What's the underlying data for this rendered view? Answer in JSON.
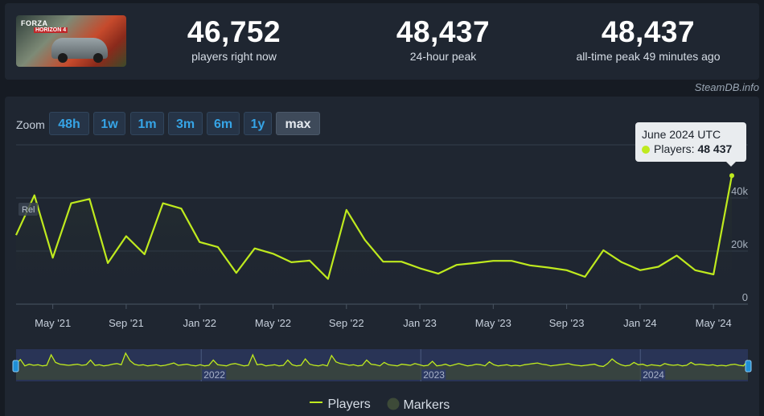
{
  "header": {
    "game_title_logo": "FORZA HORIZON 4",
    "stats": [
      {
        "value": "46,752",
        "label": "players right now"
      },
      {
        "value": "48,437",
        "label": "24-hour peak"
      },
      {
        "value": "48,437",
        "label": "all-time peak 49 minutes ago"
      }
    ]
  },
  "credit": "SteamDB.info",
  "zoom": {
    "label": "Zoom",
    "buttons": [
      "48h",
      "1w",
      "1m",
      "3m",
      "6m",
      "1y",
      "max"
    ],
    "active": "max"
  },
  "tooltip": {
    "title": "June 2024 UTC",
    "series": "Players:",
    "value": "48 437"
  },
  "chart_data": {
    "type": "line",
    "series": [
      {
        "name": "Players",
        "color": "#bfea1e",
        "x": [
          "2021-03",
          "2021-04",
          "2021-05",
          "2021-06",
          "2021-07",
          "2021-08",
          "2021-09",
          "2021-10",
          "2021-11",
          "2021-12",
          "2022-01",
          "2022-02",
          "2022-03",
          "2022-04",
          "2022-05",
          "2022-06",
          "2022-07",
          "2022-08",
          "2022-09",
          "2022-10",
          "2022-11",
          "2022-12",
          "2023-01",
          "2023-02",
          "2023-03",
          "2023-04",
          "2023-05",
          "2023-06",
          "2023-07",
          "2023-08",
          "2023-09",
          "2023-10",
          "2023-11",
          "2023-12",
          "2024-01",
          "2024-02",
          "2024-03",
          "2024-04",
          "2024-05",
          "2024-06"
        ],
        "values": [
          26000,
          41000,
          17500,
          38000,
          39600,
          15500,
          25600,
          18800,
          38000,
          36000,
          23400,
          21500,
          11800,
          21000,
          19000,
          15800,
          16400,
          9500,
          35500,
          24200,
          16000,
          16000,
          13500,
          11500,
          14800,
          15500,
          16300,
          16300,
          14600,
          13800,
          12800,
          10300,
          20300,
          15800,
          12800,
          14100,
          18300,
          12800,
          11200,
          48437
        ]
      }
    ],
    "xticks": [
      "May '21",
      "Sep '21",
      "Jan '22",
      "May '22",
      "Sep '22",
      "Jan '23",
      "May '23",
      "Sep '23",
      "Jan '24",
      "May '24"
    ],
    "yticks": [
      "0",
      "20k",
      "40k"
    ],
    "ylim": [
      0,
      60000
    ],
    "grid": true,
    "legend_position": "bottom",
    "markers_label": "Markers",
    "annotation": "Rel",
    "navigator": {
      "labels": [
        "2022",
        "2023",
        "2024"
      ],
      "values": [
        28,
        35,
        24,
        27,
        25,
        26,
        24,
        25,
        43,
        30,
        27,
        26,
        25,
        26,
        27,
        25,
        26,
        34,
        25,
        26,
        24,
        25,
        27,
        28,
        26,
        46,
        33,
        27,
        25,
        26,
        24,
        25,
        26,
        24,
        25,
        27,
        29,
        25,
        26,
        27,
        25,
        24,
        26,
        24,
        25,
        34,
        26,
        25,
        24,
        27,
        28,
        26,
        24,
        25,
        43,
        26,
        27,
        24,
        25,
        26,
        24,
        25,
        34,
        26,
        24,
        25,
        36,
        27,
        25,
        24,
        26,
        24,
        42,
        31,
        28,
        27,
        25,
        26,
        24,
        25,
        34,
        27,
        26,
        24,
        30,
        26,
        25,
        24,
        27,
        26,
        25,
        28,
        26,
        24,
        25,
        32,
        24,
        25,
        27,
        24,
        26,
        28,
        26,
        24,
        25,
        27,
        26,
        24,
        31,
        26,
        24,
        25,
        26,
        24,
        25,
        24,
        26,
        27,
        28,
        29,
        27,
        26,
        24,
        25,
        26,
        27,
        28,
        26,
        25,
        24,
        25,
        26,
        27,
        24,
        23,
        28,
        36,
        30,
        26,
        24,
        25,
        30,
        26,
        27,
        24,
        26,
        25,
        24,
        28,
        26,
        25,
        26,
        24,
        25,
        30,
        26,
        27,
        26,
        25,
        26,
        24,
        25,
        24,
        26,
        27,
        25,
        24,
        34
      ]
    }
  }
}
